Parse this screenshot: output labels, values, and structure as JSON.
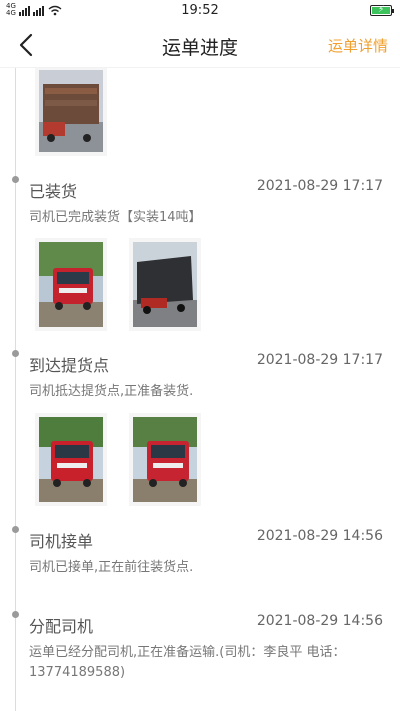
{
  "status_bar": {
    "network_top": "4G",
    "network_bottom": "4G",
    "time": "19:52",
    "battery_color": "#3cc35c"
  },
  "header": {
    "back_icon": "chevron-left-icon",
    "title": "运单进度",
    "detail_link": "运单详情",
    "accent_color": "#f0a030"
  },
  "timeline": [
    {
      "title": "已装货",
      "time": "2021-08-29 17:17",
      "description": "司机已完成装货【实装14吨】",
      "photos": [
        "truck-front-photo",
        "truck-cargo-photo"
      ]
    },
    {
      "title": "到达提货点",
      "time": "2021-08-29 17:17",
      "description": "司机抵达提货点,正准备装货.",
      "photos": [
        "truck-front-photo",
        "truck-front-photo"
      ]
    },
    {
      "title": "司机接单",
      "time": "2021-08-29 14:56",
      "description": "司机已接单,正在前往装货点."
    },
    {
      "title": "分配司机",
      "time": "2021-08-29 14:56",
      "description": "运单已经分配司机,正在准备运输.(司机：李良平 电话：13774189588)"
    }
  ]
}
